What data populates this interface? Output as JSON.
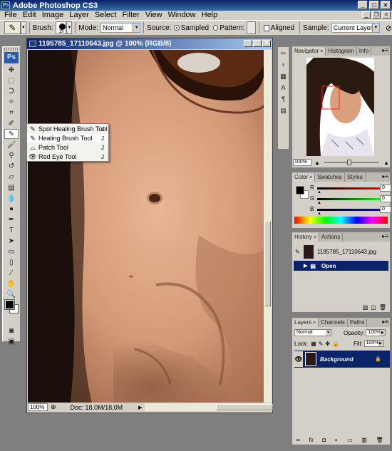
{
  "app": {
    "title": "Adobe Photoshop CS3"
  },
  "menu": [
    "File",
    "Edit",
    "Image",
    "Layer",
    "Select",
    "Filter",
    "View",
    "Window",
    "Help"
  ],
  "options": {
    "brush_label": "Brush:",
    "brush_size": "19",
    "mode_label": "Mode:",
    "mode_value": "Normal",
    "source_label": "Source:",
    "sampled_label": "Sampled",
    "pattern_label": "Pattern:",
    "aligned_label": "Aligned",
    "sample_label": "Sample:",
    "sample_value": "Current Layer"
  },
  "document": {
    "title": "1195785_17110643.jpg @ 100% (RGB/8)",
    "zoom": "100%",
    "doc_size": "Doc: 18,0M/18,0M"
  },
  "flyout": [
    {
      "label": "Spot Healing Brush Tool",
      "key": "J",
      "icon": "spot-healing-icon"
    },
    {
      "label": "Healing Brush Tool",
      "key": "J",
      "icon": "healing-brush-icon"
    },
    {
      "label": "Patch Tool",
      "key": "J",
      "icon": "patch-icon"
    },
    {
      "label": "Red Eye Tool",
      "key": "J",
      "icon": "red-eye-icon"
    }
  ],
  "navigator": {
    "tabs": [
      "Navigator",
      "Histogram",
      "Info"
    ],
    "zoom": "100%"
  },
  "color": {
    "tabs": [
      "Color",
      "Swatches",
      "Styles"
    ],
    "channels": [
      {
        "label": "R",
        "value": "0",
        "bar": "#ff0000"
      },
      {
        "label": "G",
        "value": "0",
        "bar": "#00ff00"
      },
      {
        "label": "B",
        "value": "0",
        "bar": "#0000ff"
      }
    ]
  },
  "history": {
    "tabs": [
      "History",
      "Actions"
    ],
    "snapshot": "1195785_17110643.jpg",
    "step": "Open"
  },
  "layers": {
    "tabs": [
      "Layers",
      "Channels",
      "Paths"
    ],
    "blend_mode": "Normal",
    "opacity_label": "Opacity:",
    "opacity": "100%",
    "lock_label": "Lock:",
    "fill_label": "Fill:",
    "fill": "100%",
    "layer_name": "Background"
  },
  "colors": {
    "selection": "#0a246a",
    "chrome": "#d4d0c8",
    "workspace": "#7f7f7f"
  }
}
